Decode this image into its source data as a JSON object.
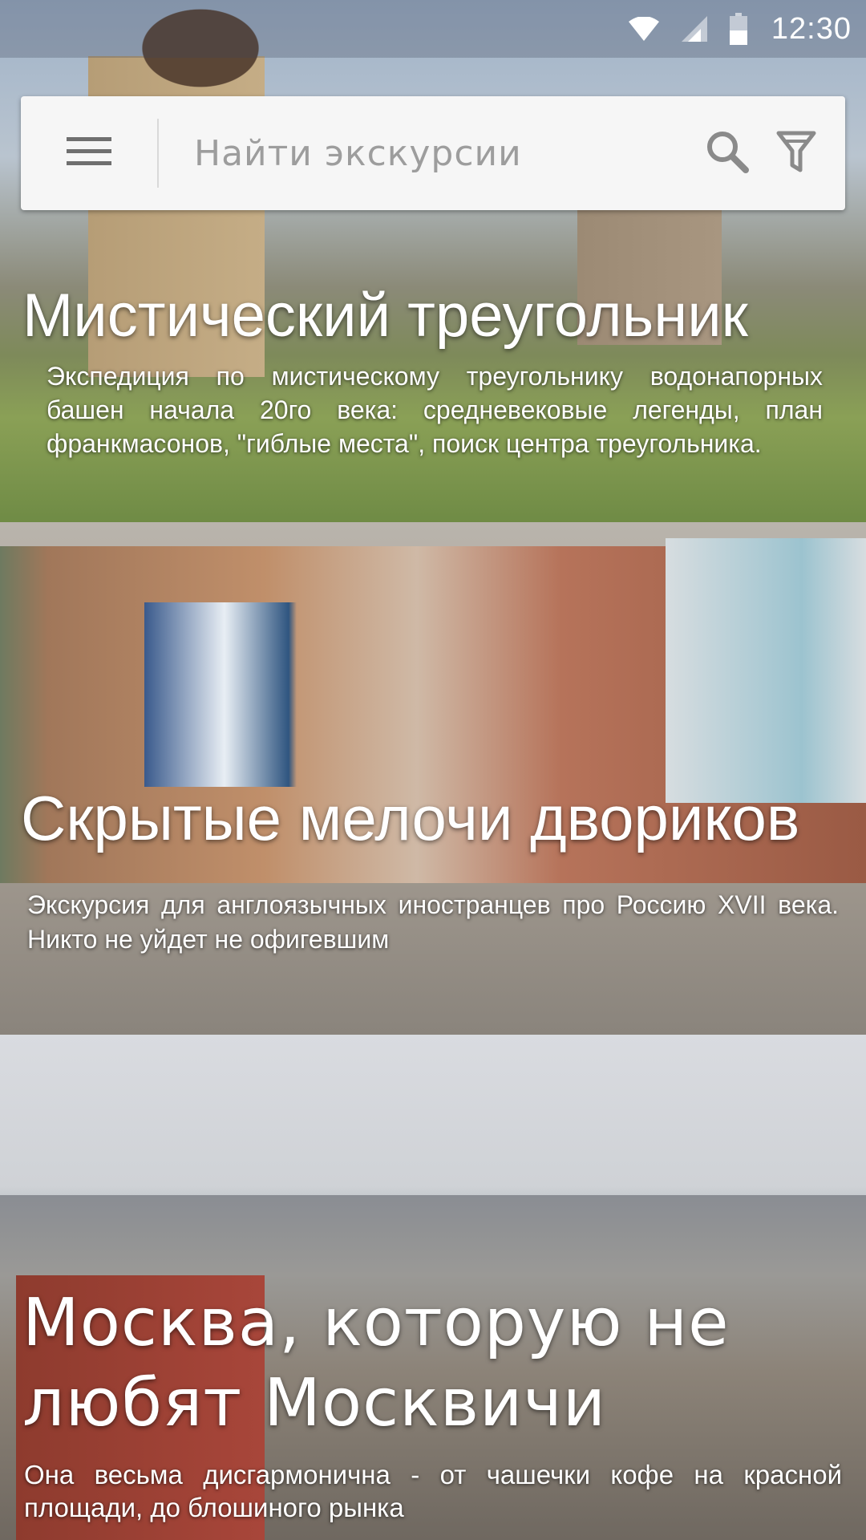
{
  "status_bar": {
    "time": "12:30",
    "icons": [
      "wifi-icon",
      "cell-signal-icon",
      "battery-icon"
    ]
  },
  "search": {
    "placeholder": "Найти экскурсии",
    "value": ""
  },
  "tours": [
    {
      "title": "Мистический треугольник",
      "description": "Экспедиция по мистическому треугольнику водонапорных башен начала 20го века: средневековые легенды, план франкмасонов, \"гиблые места\", поиск центра треугольника."
    },
    {
      "title": "Скрытые мелочи двориков",
      "description": "Экскурсия для англоязычных иностранцев про Россию XVII века. Никто не уйдет не офигевшим"
    },
    {
      "title": "Москва, которую не любят Москвичи",
      "description": "Она весьма дисгармонична - от чашечки кофе на красной площади, до блошиного рынка"
    }
  ]
}
